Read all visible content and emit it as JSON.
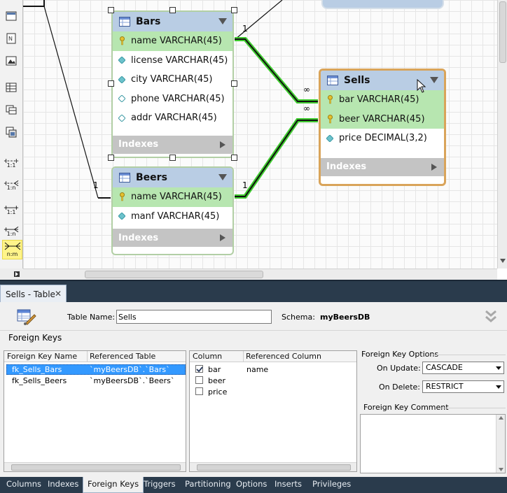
{
  "toolbar": {
    "rel_11_a": "1:1",
    "rel_1n_a": "1:n",
    "rel_11_b": "1:1",
    "rel_1n_b": "1:n",
    "rel_nm": "n:m"
  },
  "diagram": {
    "bars": {
      "title": "Bars",
      "columns": [
        "name VARCHAR(45)",
        "license VARCHAR(45)",
        "city VARCHAR(45)",
        "phone VARCHAR(45)",
        "addr VARCHAR(45)"
      ],
      "indexes": "Indexes"
    },
    "beers": {
      "title": "Beers",
      "columns": [
        "name VARCHAR(45)",
        "manf VARCHAR(45)"
      ],
      "indexes": "Indexes"
    },
    "sells": {
      "title": "Sells",
      "columns": [
        "bar VARCHAR(45)",
        "beer VARCHAR(45)",
        "price DECIMAL(3,2)"
      ],
      "indexes": "Indexes"
    },
    "cardinality": {
      "bars_one": "1",
      "top_one": "1",
      "beers_one": "1",
      "sells_many_a": "∞",
      "sells_many_b": "∞",
      "left_one": "1"
    }
  },
  "editor": {
    "tab_label": "Sells - Table",
    "table_name_label": "Table Name:",
    "table_name_value": "Sells",
    "schema_label": "Schema:",
    "schema_value": "myBeersDB",
    "section_title": "Foreign Keys",
    "fk_list": {
      "headers": [
        "Foreign Key Name",
        "Referenced Table"
      ],
      "rows": [
        {
          "name": "fk_Sells_Bars",
          "table": "`myBeersDB`.`Bars`"
        },
        {
          "name": "fk_Sells_Beers",
          "table": "`myBeersDB`.`Beers`"
        }
      ]
    },
    "columns": {
      "headers": [
        "Column",
        "Referenced Column"
      ],
      "rows": [
        {
          "name": "bar",
          "ref": "name",
          "checked": true
        },
        {
          "name": "beer",
          "ref": "",
          "checked": false
        },
        {
          "name": "price",
          "ref": "",
          "checked": false
        }
      ]
    },
    "options": {
      "title": "Foreign Key Options",
      "on_update_label": "On Update:",
      "on_update_value": "CASCADE",
      "on_delete_label": "On Delete:",
      "on_delete_value": "RESTRICT",
      "comment_title": "Foreign Key Comment"
    },
    "bottom_tabs": [
      "Columns",
      "Indexes",
      "Foreign Keys",
      "Triggers",
      "Partitioning",
      "Options",
      "Inserts",
      "Privileges"
    ],
    "active_tab": "Foreign Keys"
  }
}
